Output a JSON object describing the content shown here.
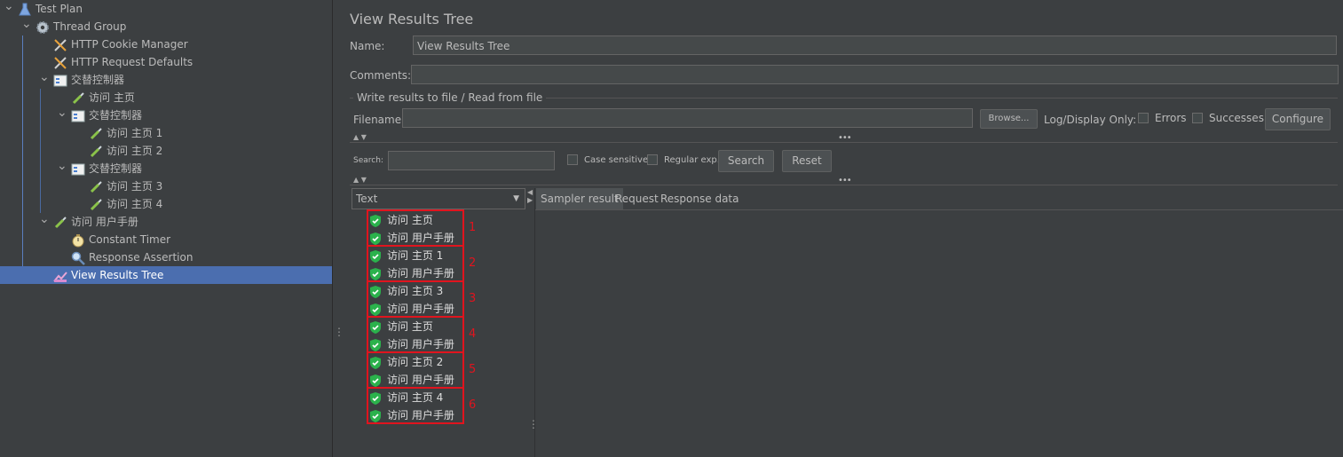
{
  "tree": {
    "items": [
      {
        "label": "Test Plan",
        "icon": "flask-icon",
        "level": 0,
        "expanded": true
      },
      {
        "label": "Thread Group",
        "icon": "gear-icon",
        "level": 1,
        "expanded": true
      },
      {
        "label": "HTTP Cookie Manager",
        "icon": "wrench-icon",
        "level": 2
      },
      {
        "label": "HTTP Request Defaults",
        "icon": "wrench-icon",
        "level": 2
      },
      {
        "label": "交替控制器",
        "icon": "controller-icon",
        "level": 2,
        "expanded": true
      },
      {
        "label": "访问 主页",
        "icon": "pipette-icon",
        "level": 3
      },
      {
        "label": "交替控制器",
        "icon": "controller-icon",
        "level": 3,
        "expanded": true
      },
      {
        "label": "访问 主页 1",
        "icon": "pipette-icon",
        "level": 4
      },
      {
        "label": "访问 主页 2",
        "icon": "pipette-icon",
        "level": 4
      },
      {
        "label": "交替控制器",
        "icon": "controller-icon",
        "level": 3,
        "expanded": true
      },
      {
        "label": "访问 主页 3",
        "icon": "pipette-icon",
        "level": 4
      },
      {
        "label": "访问 主页 4",
        "icon": "pipette-icon",
        "level": 4
      },
      {
        "label": "访问 用户手册",
        "icon": "pipette-icon",
        "level": 2,
        "expanded": true
      },
      {
        "label": "Constant Timer",
        "icon": "stopwatch-icon",
        "level": 3
      },
      {
        "label": "Response Assertion",
        "icon": "magnifier-icon",
        "level": 3
      },
      {
        "label": "View Results Tree",
        "icon": "chart-icon",
        "level": 2,
        "selected": true
      }
    ]
  },
  "panel": {
    "title": "View Results Tree",
    "name_label": "Name:",
    "name_value": "View Results Tree",
    "comments_label": "Comments:",
    "comments_value": "",
    "file_group_title": "Write results to file / Read from file",
    "filename_label": "Filename",
    "filename_value": "",
    "browse_label": "Browse...",
    "log_display_label": "Log/Display Only:",
    "errors_label": "Errors",
    "successes_label": "Successes",
    "configure_label": "Configure",
    "search_label": "Search:",
    "search_value": "",
    "case_sensitive_label": "Case sensitive",
    "regex_label": "Regular exp.",
    "search_button": "Search",
    "reset_button": "Reset",
    "renderer_selected": "Text",
    "tabs": [
      "Sampler result",
      "Request",
      "Response data"
    ]
  },
  "results": [
    {
      "group": "1",
      "items": [
        "访问 主页",
        "访问 用户手册"
      ]
    },
    {
      "group": "2",
      "items": [
        "访问 主页 1",
        "访问 用户手册"
      ]
    },
    {
      "group": "3",
      "items": [
        "访问 主页 3",
        "访问 用户手册"
      ]
    },
    {
      "group": "4",
      "items": [
        "访问 主页",
        "访问 用户手册"
      ]
    },
    {
      "group": "5",
      "items": [
        "访问 主页 2",
        "访问 用户手册"
      ]
    },
    {
      "group": "6",
      "items": [
        "访问 主页 4",
        "访问 用户手册"
      ]
    }
  ],
  "colors": {
    "selection": "#4b6eaf",
    "annotation": "#e0141e",
    "success": "#2bb24c"
  }
}
